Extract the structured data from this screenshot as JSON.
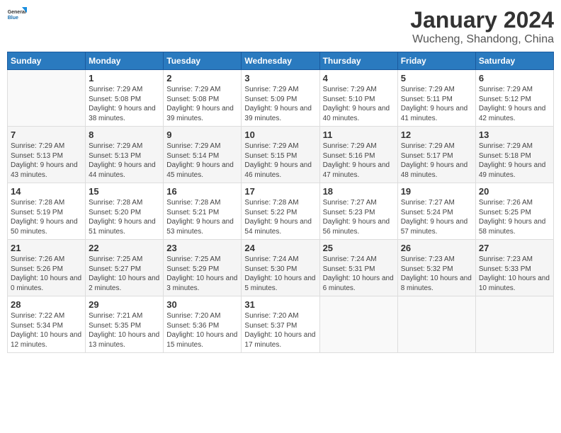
{
  "logo": {
    "general": "General",
    "blue": "Blue"
  },
  "title": {
    "month": "January 2024",
    "location": "Wucheng, Shandong, China"
  },
  "weekdays": [
    "Sunday",
    "Monday",
    "Tuesday",
    "Wednesday",
    "Thursday",
    "Friday",
    "Saturday"
  ],
  "weeks": [
    [
      {
        "day": "",
        "empty": true
      },
      {
        "day": "1",
        "sunrise": "7:29 AM",
        "sunset": "5:08 PM",
        "daylight": "9 hours and 38 minutes."
      },
      {
        "day": "2",
        "sunrise": "7:29 AM",
        "sunset": "5:08 PM",
        "daylight": "9 hours and 39 minutes."
      },
      {
        "day": "3",
        "sunrise": "7:29 AM",
        "sunset": "5:09 PM",
        "daylight": "9 hours and 39 minutes."
      },
      {
        "day": "4",
        "sunrise": "7:29 AM",
        "sunset": "5:10 PM",
        "daylight": "9 hours and 40 minutes."
      },
      {
        "day": "5",
        "sunrise": "7:29 AM",
        "sunset": "5:11 PM",
        "daylight": "9 hours and 41 minutes."
      },
      {
        "day": "6",
        "sunrise": "7:29 AM",
        "sunset": "5:12 PM",
        "daylight": "9 hours and 42 minutes."
      }
    ],
    [
      {
        "day": "7",
        "sunrise": "7:29 AM",
        "sunset": "5:13 PM",
        "daylight": "9 hours and 43 minutes."
      },
      {
        "day": "8",
        "sunrise": "7:29 AM",
        "sunset": "5:13 PM",
        "daylight": "9 hours and 44 minutes."
      },
      {
        "day": "9",
        "sunrise": "7:29 AM",
        "sunset": "5:14 PM",
        "daylight": "9 hours and 45 minutes."
      },
      {
        "day": "10",
        "sunrise": "7:29 AM",
        "sunset": "5:15 PM",
        "daylight": "9 hours and 46 minutes."
      },
      {
        "day": "11",
        "sunrise": "7:29 AM",
        "sunset": "5:16 PM",
        "daylight": "9 hours and 47 minutes."
      },
      {
        "day": "12",
        "sunrise": "7:29 AM",
        "sunset": "5:17 PM",
        "daylight": "9 hours and 48 minutes."
      },
      {
        "day": "13",
        "sunrise": "7:29 AM",
        "sunset": "5:18 PM",
        "daylight": "9 hours and 49 minutes."
      }
    ],
    [
      {
        "day": "14",
        "sunrise": "7:28 AM",
        "sunset": "5:19 PM",
        "daylight": "9 hours and 50 minutes."
      },
      {
        "day": "15",
        "sunrise": "7:28 AM",
        "sunset": "5:20 PM",
        "daylight": "9 hours and 51 minutes."
      },
      {
        "day": "16",
        "sunrise": "7:28 AM",
        "sunset": "5:21 PM",
        "daylight": "9 hours and 53 minutes."
      },
      {
        "day": "17",
        "sunrise": "7:28 AM",
        "sunset": "5:22 PM",
        "daylight": "9 hours and 54 minutes."
      },
      {
        "day": "18",
        "sunrise": "7:27 AM",
        "sunset": "5:23 PM",
        "daylight": "9 hours and 56 minutes."
      },
      {
        "day": "19",
        "sunrise": "7:27 AM",
        "sunset": "5:24 PM",
        "daylight": "9 hours and 57 minutes."
      },
      {
        "day": "20",
        "sunrise": "7:26 AM",
        "sunset": "5:25 PM",
        "daylight": "9 hours and 58 minutes."
      }
    ],
    [
      {
        "day": "21",
        "sunrise": "7:26 AM",
        "sunset": "5:26 PM",
        "daylight": "10 hours and 0 minutes."
      },
      {
        "day": "22",
        "sunrise": "7:25 AM",
        "sunset": "5:27 PM",
        "daylight": "10 hours and 2 minutes."
      },
      {
        "day": "23",
        "sunrise": "7:25 AM",
        "sunset": "5:29 PM",
        "daylight": "10 hours and 3 minutes."
      },
      {
        "day": "24",
        "sunrise": "7:24 AM",
        "sunset": "5:30 PM",
        "daylight": "10 hours and 5 minutes."
      },
      {
        "day": "25",
        "sunrise": "7:24 AM",
        "sunset": "5:31 PM",
        "daylight": "10 hours and 6 minutes."
      },
      {
        "day": "26",
        "sunrise": "7:23 AM",
        "sunset": "5:32 PM",
        "daylight": "10 hours and 8 minutes."
      },
      {
        "day": "27",
        "sunrise": "7:23 AM",
        "sunset": "5:33 PM",
        "daylight": "10 hours and 10 minutes."
      }
    ],
    [
      {
        "day": "28",
        "sunrise": "7:22 AM",
        "sunset": "5:34 PM",
        "daylight": "10 hours and 12 minutes."
      },
      {
        "day": "29",
        "sunrise": "7:21 AM",
        "sunset": "5:35 PM",
        "daylight": "10 hours and 13 minutes."
      },
      {
        "day": "30",
        "sunrise": "7:20 AM",
        "sunset": "5:36 PM",
        "daylight": "10 hours and 15 minutes."
      },
      {
        "day": "31",
        "sunrise": "7:20 AM",
        "sunset": "5:37 PM",
        "daylight": "10 hours and 17 minutes."
      },
      {
        "day": "",
        "empty": true
      },
      {
        "day": "",
        "empty": true
      },
      {
        "day": "",
        "empty": true
      }
    ]
  ],
  "labels": {
    "sunrise": "Sunrise:",
    "sunset": "Sunset:",
    "daylight": "Daylight:"
  }
}
